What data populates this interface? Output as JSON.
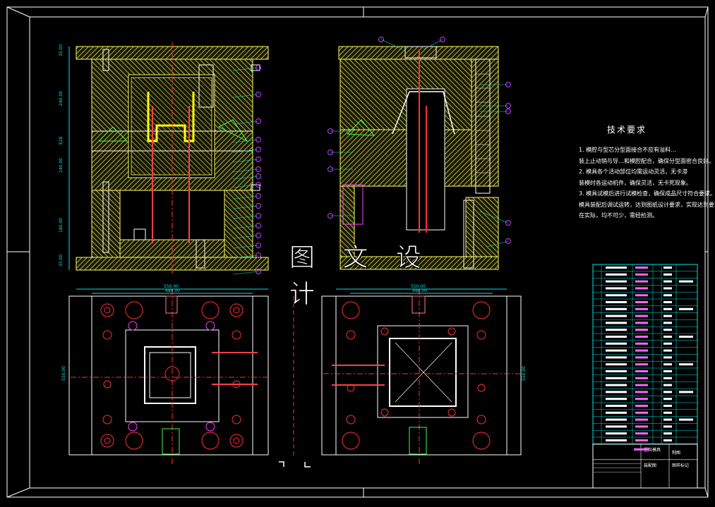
{
  "colors": {
    "background": "#000000",
    "border": "#ffffff",
    "plate": "#ffff66",
    "dim": "#00e5e5",
    "callout": "#c040ff",
    "center": "#ff3030",
    "green": "#40ff40",
    "magenta": "#ff40ff"
  },
  "watermark": "图 文 设 计",
  "tech": {
    "title": "技术要求",
    "lines": [
      "1. 模腔与型芯分型面接合不应有溢料…",
      "装上止动销与导…和模腔配合，确保分型面密合良好。",
      "2. 模具各个活动部位均需运动灵活，无卡滞",
      "装模时各运动机件，确保灵活，无卡死现象。",
      "3. 模具试模后进行试模检查，确保成品尺寸符合要求。",
      "模具装配后调试运转，达到图纸设计要求，实现达到要求值。",
      "在实际，均不可少，需经检测。"
    ]
  },
  "dims": {
    "front_top": "550.00",
    "front_inner": "480.00",
    "side_top": "550.00",
    "side_inner": "480.00",
    "side_left": "550.00",
    "side_right": "550.00",
    "left_v1": "35.00",
    "left_v2": "240.00",
    "left_v3": "140.00",
    "left_v4": "180.00",
    "left_v5": "35.00",
    "left_total": "628"
  },
  "bom_rows": 26,
  "title_block": {
    "cells": [
      "塑料模具",
      "制图",
      "装配图",
      "图样标记"
    ]
  }
}
